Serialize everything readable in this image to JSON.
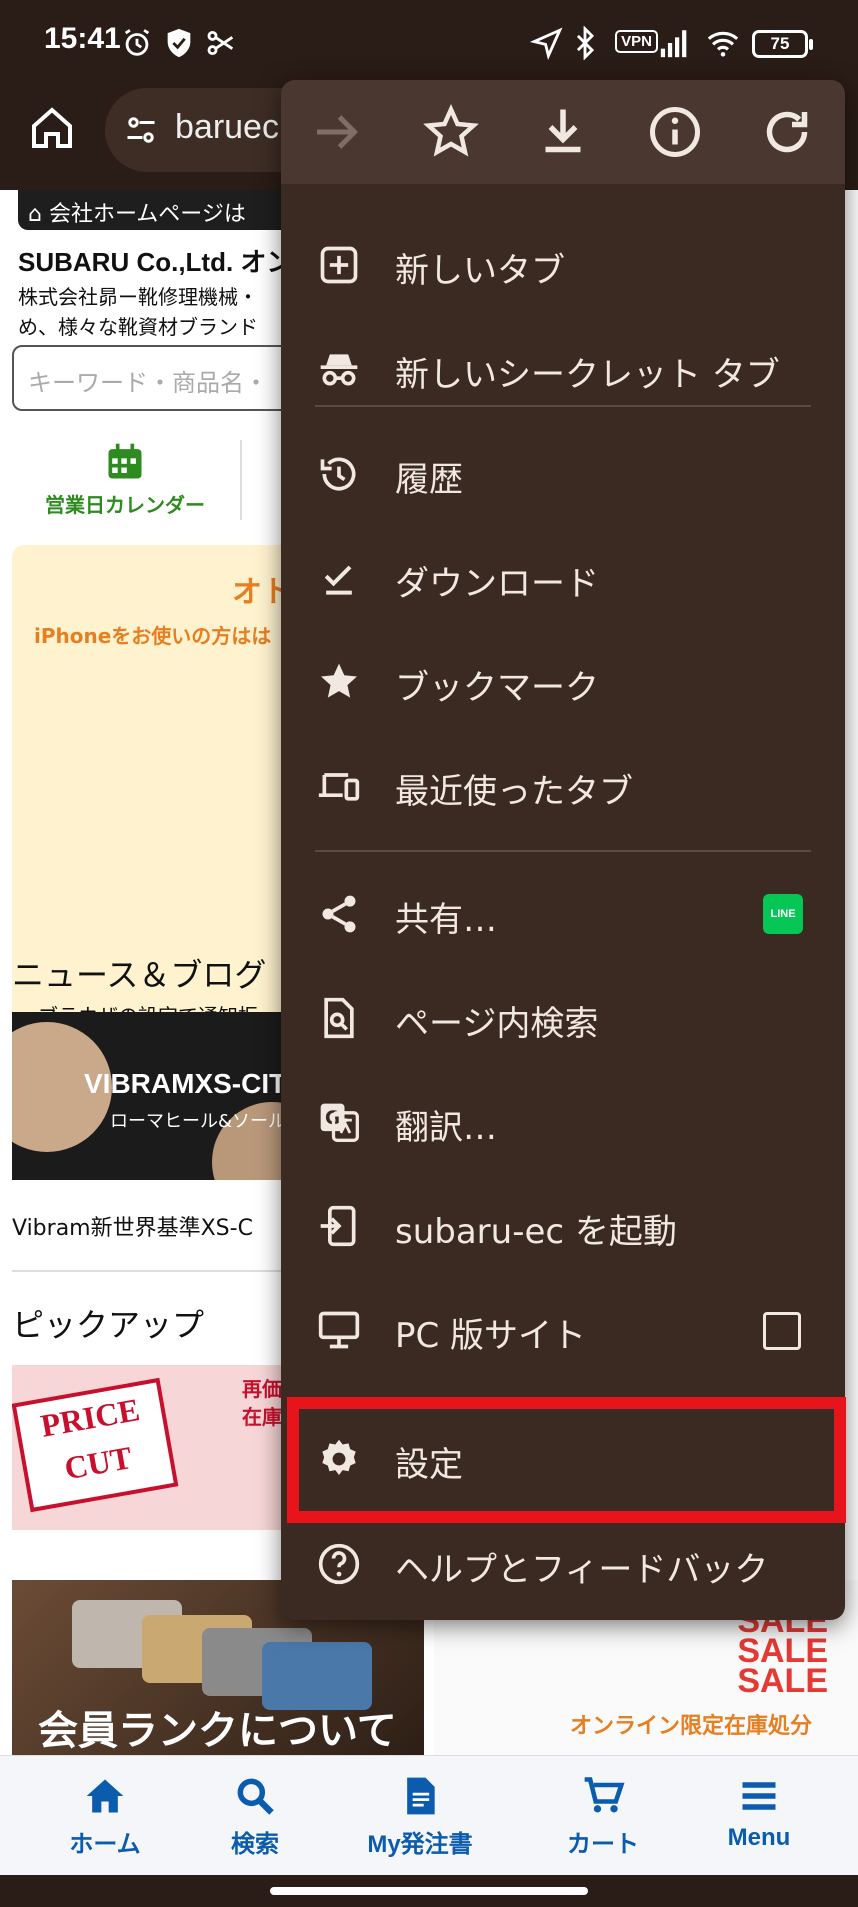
{
  "status_bar": {
    "time": "15:41",
    "vpn": "VPN",
    "battery": "75"
  },
  "browser": {
    "url": "baruec.",
    "menu_open": true
  },
  "page": {
    "notice": "会社ホームページは",
    "company": "SUBARU Co.,Ltd. オン",
    "description": [
      "株式会社昴ー靴修理機械・",
      "め、様々な靴資材ブランド"
    ],
    "search_placeholder": "キーワード・商品名・",
    "calendar_label": "営業日カレンダー",
    "promo_title": "オト",
    "promo_iphone": "iPhoneをお使いの方はは",
    "promo_browser": "ブラウザの設定で通知拒",
    "news_heading": "ニュース＆ブログ",
    "news_image_title": "VIBRAMXS-CITY",
    "news_image_sub": "ローマヒール&ソール",
    "news_title": "Vibram新世界基準XS-C",
    "pickup_heading": "ピックアップ",
    "pickup_badge": "PRICE CUT",
    "pickup_text": [
      "再価",
      "在庫処"
    ],
    "rank_banner": "会員ランクについて",
    "sale_banner": [
      "SALE",
      "SALE",
      "SALE"
    ],
    "sale_sub": "オンライン限定在庫処分"
  },
  "bottom_nav": [
    {
      "label": "ホーム",
      "icon": "home-icon"
    },
    {
      "label": "検索",
      "icon": "search-icon"
    },
    {
      "label": "My発注書",
      "icon": "document-icon"
    },
    {
      "label": "カート",
      "icon": "cart-icon"
    },
    {
      "label": "Menu",
      "icon": "menu-icon"
    }
  ],
  "menu": {
    "top_bar": [
      "forward-icon",
      "star-icon",
      "download-icon",
      "info-icon",
      "refresh-icon"
    ],
    "items": [
      {
        "label": "新しいタブ",
        "icon": "new-tab-icon"
      },
      {
        "label": "新しいシークレット タブ",
        "icon": "incognito-icon"
      },
      {
        "label": "履歴",
        "icon": "history-icon"
      },
      {
        "label": "ダウンロード",
        "icon": "download-check-icon"
      },
      {
        "label": "ブックマーク",
        "icon": "bookmark-star-icon"
      },
      {
        "label": "最近使ったタブ",
        "icon": "devices-icon"
      },
      {
        "label": "共有…",
        "icon": "share-icon",
        "badge": "LINE"
      },
      {
        "label": "ページ内検索",
        "icon": "find-in-page-icon"
      },
      {
        "label": "翻訳…",
        "icon": "translate-icon"
      },
      {
        "label": "subaru-ec を起動",
        "icon": "open-app-icon"
      },
      {
        "label": "PC 版サイト",
        "icon": "desktop-icon",
        "checked": false
      },
      {
        "label": "設定",
        "icon": "gear-icon",
        "highlighted": true
      },
      {
        "label": "ヘルプとフィードバック",
        "icon": "help-icon"
      }
    ]
  },
  "colors": {
    "menu_bg": "#3a2a22",
    "highlight": "#e8141c",
    "nav_blue": "#0b5cad"
  }
}
